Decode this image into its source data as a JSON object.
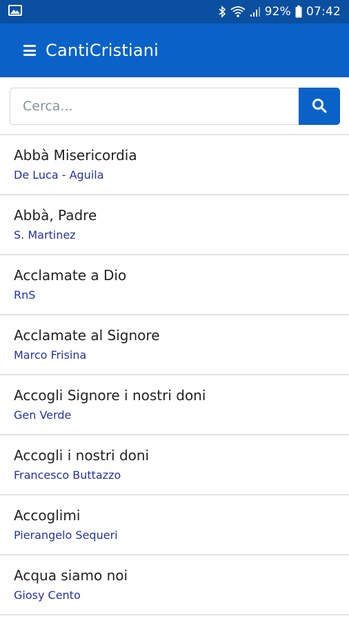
{
  "status_bar": {
    "battery": "92%",
    "time": "07:42",
    "icons": [
      "image-icon",
      "bluetooth-icon",
      "wifi-icon",
      "signal-icon",
      "battery-icon"
    ]
  },
  "app_bar": {
    "title": "CantiCristiani",
    "menu_icon": "hamburger-menu-icon"
  },
  "search": {
    "placeholder": "Cerca...",
    "value": "",
    "button_icon": "search-icon"
  },
  "colors": {
    "status_bar": "#0b4fa0",
    "app_bar": "#0a62c9",
    "author_text": "#2330a8",
    "title_text": "#222222"
  },
  "songs": [
    {
      "title": "Abbà Misericordia",
      "author": "De Luca - Aguila"
    },
    {
      "title": "Abbà, Padre",
      "author": "S. Martinez"
    },
    {
      "title": "Acclamate a Dio",
      "author": "RnS"
    },
    {
      "title": "Acclamate al Signore",
      "author": "Marco Frisina"
    },
    {
      "title": "Accogli Signore i nostri doni",
      "author": "Gen Verde"
    },
    {
      "title": "Accogli i nostri doni",
      "author": "Francesco Buttazzo"
    },
    {
      "title": "Accoglimi",
      "author": "Pierangelo Sequeri"
    },
    {
      "title": "Acqua siamo noi",
      "author": "Giosy Cento"
    }
  ]
}
